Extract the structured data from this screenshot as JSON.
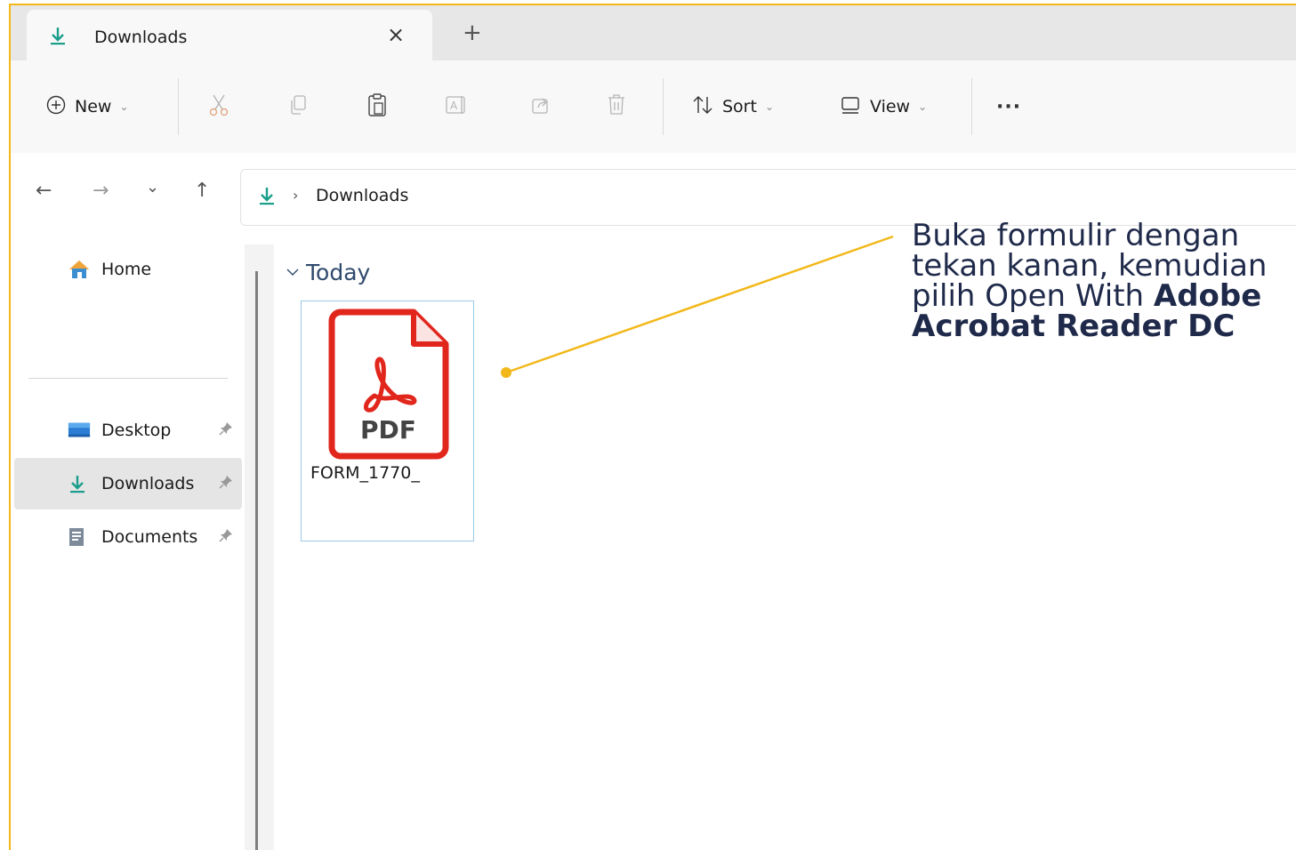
{
  "tab": {
    "title": "Downloads",
    "close_glyph": "×",
    "new_tab_glyph": "+"
  },
  "toolbar": {
    "new_label": "New",
    "sort_label": "Sort",
    "view_label": "View",
    "more_label": "···",
    "icons": [
      "plus-circle-icon",
      "cut-icon",
      "copy-icon",
      "paste-icon",
      "rename-icon",
      "share-icon",
      "delete-icon",
      "sort-icon",
      "view-icon",
      "more-icon"
    ]
  },
  "nav": {
    "back": "←",
    "forward": "→",
    "recent": "⌄",
    "up": "↑"
  },
  "address": {
    "separator": "›",
    "location": "Downloads"
  },
  "sidebar": {
    "items": [
      {
        "label": "Home"
      },
      {
        "label": "Desktop"
      },
      {
        "label": "Downloads"
      },
      {
        "label": "Documents"
      }
    ],
    "pin_glyph": "📌"
  },
  "content": {
    "group_label": "Today",
    "file": {
      "name": "FORM_1770_",
      "icon_text": "PDF"
    }
  },
  "callout": {
    "line1": "Buka formulir dengan",
    "line2": "tekan kanan, kemudian",
    "line3_plain": "pilih Open With ",
    "line3_bold": "Adobe",
    "line4_bold": "Acrobat Reader DC"
  },
  "colors": {
    "accent_yellow": "#f2b81a",
    "download_green": "#1a9e8c",
    "pdf_red": "#e1261c"
  }
}
